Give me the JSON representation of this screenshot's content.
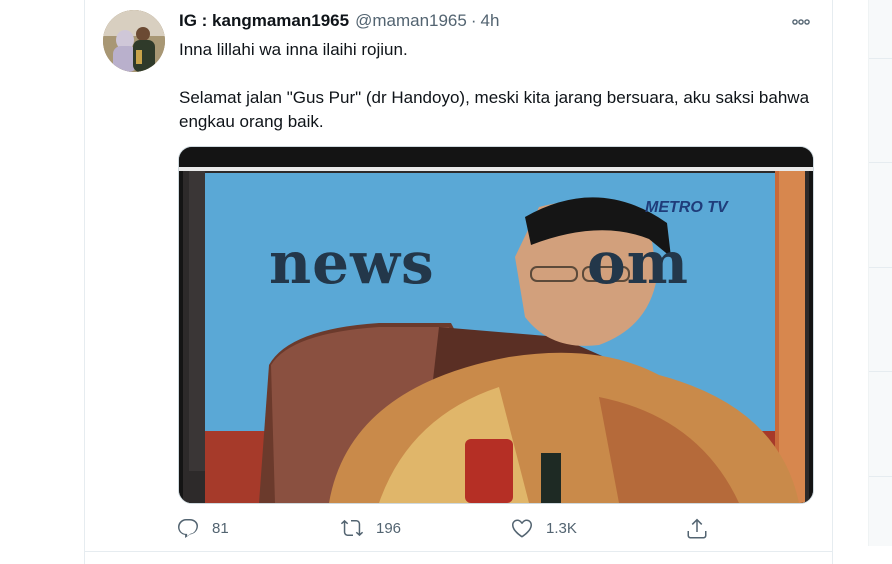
{
  "tweet": {
    "display_name": "IG : kangmaman1965",
    "handle": "@maman1965",
    "separator": "·",
    "time": "4h",
    "text_line1": "Inna lillahi wa inna ilaihi rojiun.",
    "text_paragraph2": "Selamat jalan \"Gus Pur\" (dr Handoyo), meski kita jarang bersuara, aku saksi bahwa engkau orang baik.",
    "media": {
      "studio_text": "news",
      "studio_text_end": "om",
      "channel_logo": "METRO TV"
    },
    "actions": {
      "reply": {
        "icon": "reply-icon",
        "count": "81"
      },
      "retweet": {
        "icon": "retweet-icon",
        "count": "196"
      },
      "like": {
        "icon": "heart-icon",
        "count": "1.3K"
      },
      "share": {
        "icon": "share-icon"
      }
    }
  },
  "icons": {
    "more": "more-dots-icon"
  },
  "colors": {
    "text": "#0f1419",
    "secondary": "#536471",
    "border": "#e6ecf0"
  }
}
